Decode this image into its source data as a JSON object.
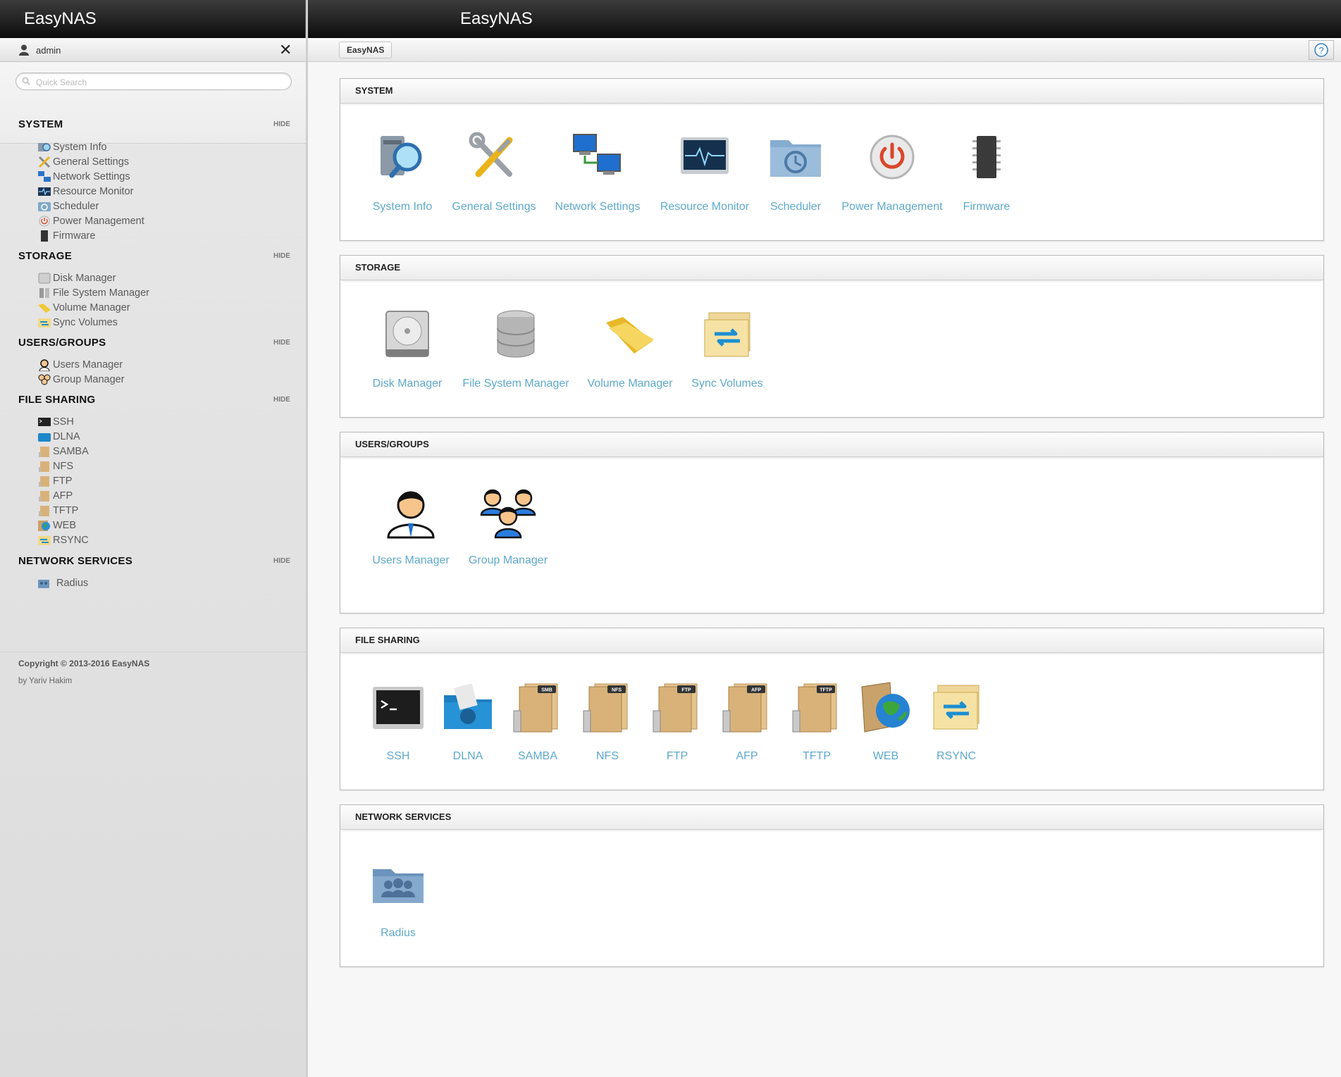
{
  "app": {
    "title": "EasyNAS"
  },
  "user": {
    "name": "admin"
  },
  "search": {
    "placeholder": "Quick Search"
  },
  "breadcrumb": [
    "EasyNAS"
  ],
  "hide_label": "HIDE",
  "sidebar": {
    "sections": [
      {
        "title": "SYSTEM",
        "items": [
          "System Info",
          "General Settings",
          "Network Settings",
          "Resource Monitor",
          "Scheduler",
          "Power Management",
          "Firmware"
        ]
      },
      {
        "title": "STORAGE",
        "items": [
          "Disk Manager",
          "File System Manager",
          "Volume Manager",
          "Sync Volumes"
        ]
      },
      {
        "title": "USERS/GROUPS",
        "items": [
          "Users Manager",
          "Group Manager"
        ]
      },
      {
        "title": "FILE SHARING",
        "items": [
          "SSH",
          "DLNA",
          "SAMBA",
          "NFS",
          "FTP",
          "AFP",
          "TFTP",
          "WEB",
          "RSYNC"
        ]
      },
      {
        "title": "NETWORK SERVICES",
        "items": [
          "Radius"
        ]
      }
    ]
  },
  "footer": {
    "copyright": "Copyright © 2013-2016 EasyNAS",
    "author": "by Yariv Hakim"
  },
  "panels": [
    {
      "title": "SYSTEM",
      "tiles": [
        "System Info",
        "General Settings",
        "Network Settings",
        "Resource Monitor",
        "Scheduler",
        "Power Management",
        "Firmware"
      ]
    },
    {
      "title": "STORAGE",
      "tiles": [
        "Disk Manager",
        "File System Manager",
        "Volume Manager",
        "Sync Volumes"
      ]
    },
    {
      "title": "USERS/GROUPS",
      "tiles": [
        "Users Manager",
        "Group Manager"
      ]
    },
    {
      "title": "FILE SHARING",
      "tiles": [
        "SSH",
        "DLNA",
        "SAMBA",
        "NFS",
        "FTP",
        "AFP",
        "TFTP",
        "WEB",
        "RSYNC"
      ]
    },
    {
      "title": "NETWORK SERVICES",
      "tiles": [
        "Radius"
      ]
    }
  ],
  "folder_badges": {
    "samba": "SMB",
    "nfs": "NFS",
    "ftp": "FTP",
    "afp": "AFP",
    "tftp": "TFTP"
  },
  "icons": {
    "system-info": "computer-magnifier-icon",
    "general-settings": "tools-icon",
    "network-settings": "network-computers-icon",
    "resource-monitor": "monitor-pulse-icon",
    "scheduler": "clock-folder-icon",
    "power-management": "power-icon",
    "firmware": "chip-icon",
    "disk-manager": "hard-disk-icon",
    "file-system-manager": "database-icon",
    "volume-manager": "open-folder-icon",
    "sync-volumes": "sync-folder-icon",
    "users-manager": "user-icon",
    "group-manager": "group-icon",
    "ssh": "terminal-icon",
    "dlna": "media-folder-icon",
    "web": "globe-box-icon",
    "rsync": "sync-folder-icon",
    "radius": "people-folder-icon",
    "help": "help-icon"
  },
  "colors": {
    "link": "#5ea9cc",
    "topbar": "#111111"
  }
}
